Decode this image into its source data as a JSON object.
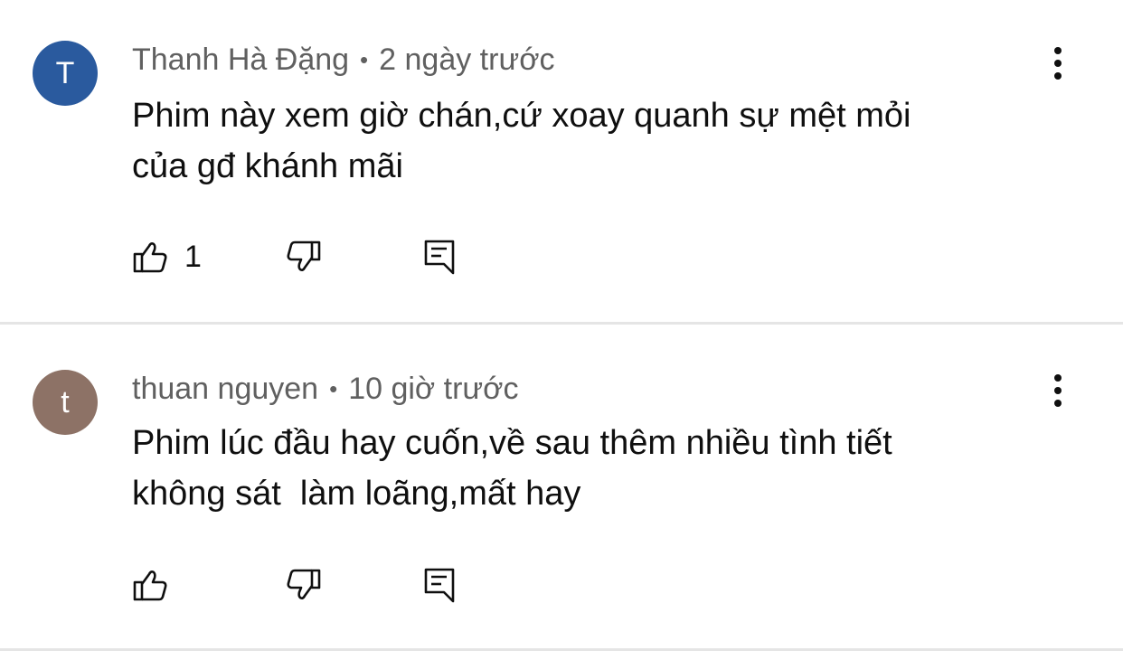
{
  "comments": [
    {
      "avatar_letter": "T",
      "avatar_color": "#2a5a9e",
      "author": "Thanh Hà Đặng",
      "time": "2 ngày trước",
      "text_line1": "Phim này xem giờ chán,cứ xoay quanh sự mệt mỏi",
      "text_line2": "của gđ khánh mãi",
      "like_count": "1"
    },
    {
      "avatar_letter": "t",
      "avatar_color": "#8d7266",
      "author": "thuan nguyen",
      "time": "10 giờ trước",
      "text_line1": "Phim lúc đầu hay cuốn,về sau thêm nhiều tình tiết",
      "text_line2": "không sát  làm loãng,mất hay",
      "like_count": ""
    }
  ],
  "separator": "•",
  "icons": {
    "like": "thumb-up-icon",
    "dislike": "thumb-down-icon",
    "reply": "reply-comment-icon",
    "menu": "more-vertical-icon"
  },
  "colors": {
    "text_primary": "#0f0f0f",
    "text_secondary": "#606060",
    "divider": "#e5e5e5"
  }
}
